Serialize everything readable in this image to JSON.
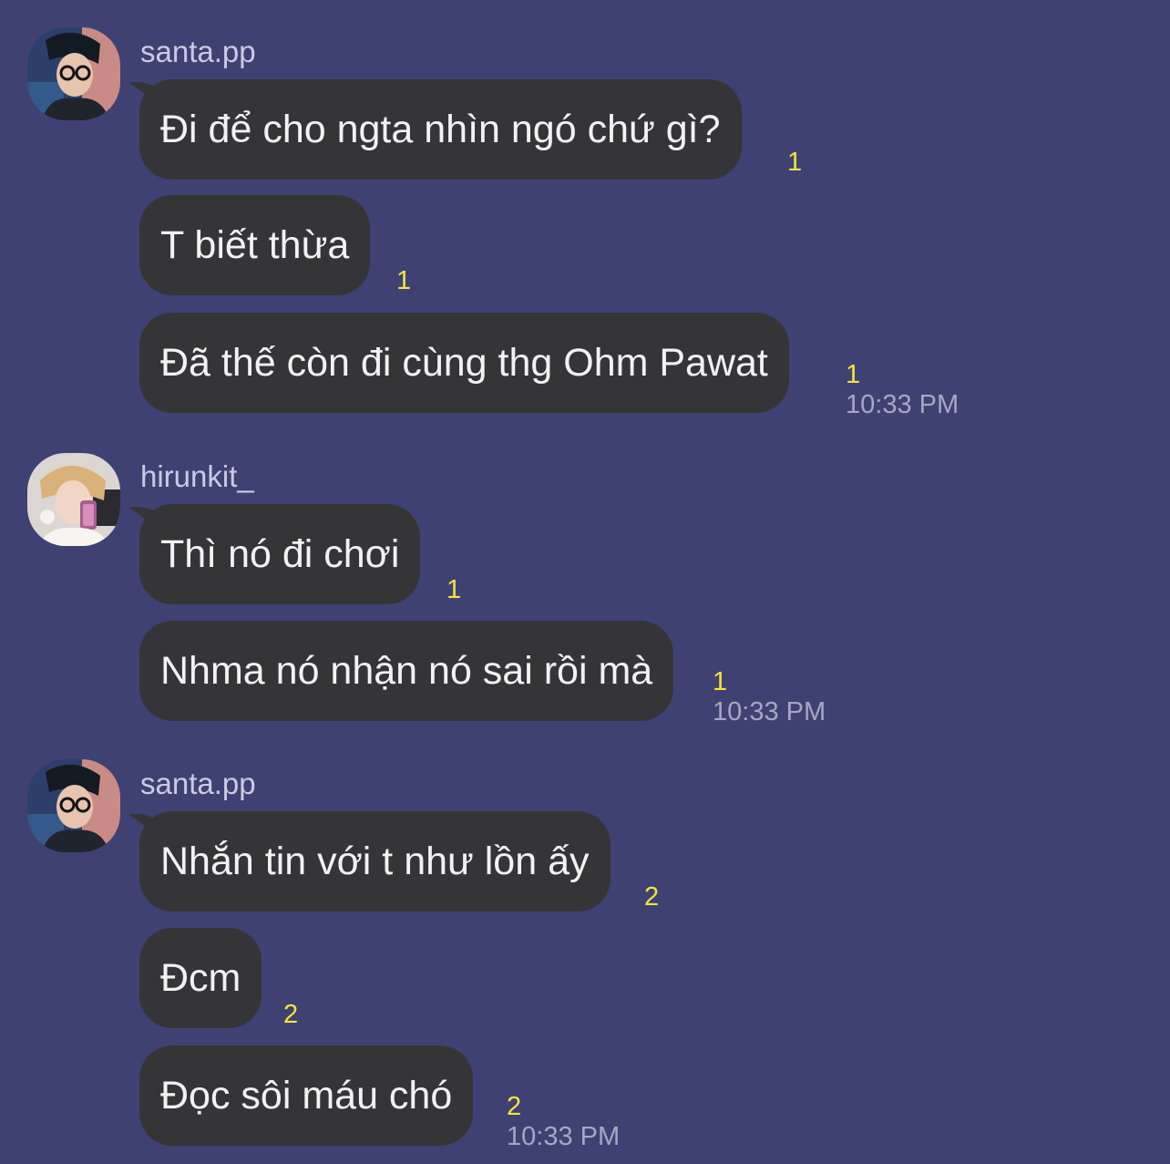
{
  "groups": [
    {
      "user": "santa.pp",
      "avatar": "santa-pp-avatar",
      "messages": [
        {
          "text": "Đi để cho ngta nhìn ngó chứ gì?",
          "unread": "1"
        },
        {
          "text": "T biết thừa",
          "unread": "1"
        },
        {
          "text": "Đã thế còn đi cùng thg Ohm Pawat",
          "unread": "1",
          "time": "10:33 PM"
        }
      ]
    },
    {
      "user": "hirunkit_",
      "avatar": "hirunkit-avatar",
      "messages": [
        {
          "text": "Thì nó đi chơi",
          "unread": "1"
        },
        {
          "text": "Nhma nó nhận nó sai rồi mà",
          "unread": "1",
          "time": "10:33 PM"
        }
      ]
    },
    {
      "user": "santa.pp",
      "avatar": "santa-pp-avatar",
      "messages": [
        {
          "text": "Nhắn tin với t như lồn ấy",
          "unread": "2"
        },
        {
          "text": "Đcm",
          "unread": "2"
        },
        {
          "text": "Đọc sôi máu chó",
          "unread": "2",
          "time": "10:33 PM"
        }
      ]
    }
  ],
  "colors": {
    "background": "#3f4173",
    "bubble": "#353538",
    "message_text": "#f2f2f2",
    "username": "#c9cbe3",
    "unread": "#f3e43a",
    "time": "#a5a7c4"
  }
}
